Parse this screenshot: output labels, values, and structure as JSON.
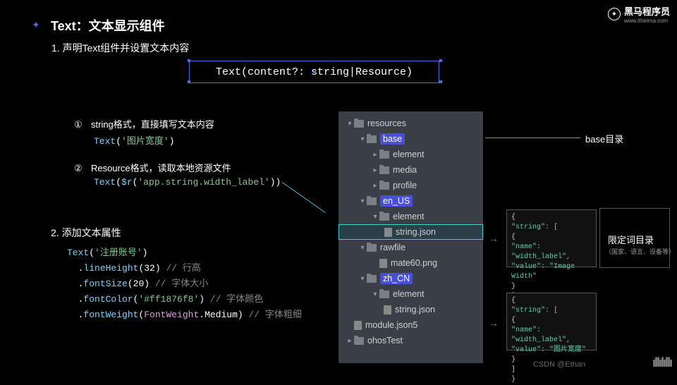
{
  "logo": {
    "text": "黑马程序员",
    "url": "www.itheima.com"
  },
  "title": "Text：文本显示组件",
  "section1": "1. 声明Text组件并设置文本内容",
  "signature": {
    "fn": "Text",
    "params": "(content?: string|Resource)"
  },
  "item1": {
    "num": "①",
    "desc": "string格式，直接填写文本内容",
    "code": {
      "fn": "Text",
      "open": "(",
      "str": "'图片宽度'",
      "close": ")"
    }
  },
  "item2": {
    "num": "②",
    "desc": "Resource格式，读取本地资源文件",
    "code": {
      "fn": "Text",
      "open": "(",
      "r": "$r",
      "ropen": "(",
      "str": "'app.string.width_label'",
      "rclose": ")",
      "close": ")"
    }
  },
  "section2": "2. 添加文本属性",
  "code2": {
    "l1": {
      "fn": "Text",
      "open": "(",
      "str": "'注册账号'",
      "close": ")"
    },
    "l2": {
      "dot": ".",
      "fn": "lineHeight",
      "args": "(32)",
      "cmt": " // 行高"
    },
    "l3": {
      "dot": ".",
      "fn": "fontSize",
      "args": "(20)",
      "cmt": " // 字体大小"
    },
    "l4": {
      "dot": ".",
      "fn": "fontColor",
      "open": "(",
      "str": "'#ff1876f8'",
      "close": ")",
      "cmt": " // 字体颜色"
    },
    "l5": {
      "dot": ".",
      "fn": "fontWeight",
      "open": "(",
      "kw": "FontWeight",
      "mem": ".Medium)",
      "cmt": " // 字体粗细"
    }
  },
  "tree": {
    "resources": "resources",
    "base": "base",
    "element": "element",
    "media": "media",
    "profile": "profile",
    "en_US": "en_US",
    "string_json": "string.json",
    "rawfile": "rawfile",
    "mate60": "mate60.png",
    "zh_CN": "zh_CN",
    "module": "module.json5",
    "ohos": "ohosTest"
  },
  "label1": "base目录",
  "label2": "限定词目录",
  "label2sub": "（国家、语言、设备等）",
  "json1": {
    "l1": "{",
    "l2": "  \"string\": [",
    "l3": "    {",
    "l4": "      \"name\": \"width_label\",",
    "l5": "      \"value\": \"Image Width\"",
    "l6": "    }",
    "l7": "  ]",
    "l8": "}"
  },
  "json2": {
    "l1": "{",
    "l2": "  \"string\": [",
    "l3": "    {",
    "l4": "      \"name\": \"width_label\",",
    "l5": "      \"value\": \"图片宽度\"",
    "l6": "    }",
    "l7": "  ]",
    "l8": "}"
  },
  "csdn": "CSDN @Ethan"
}
